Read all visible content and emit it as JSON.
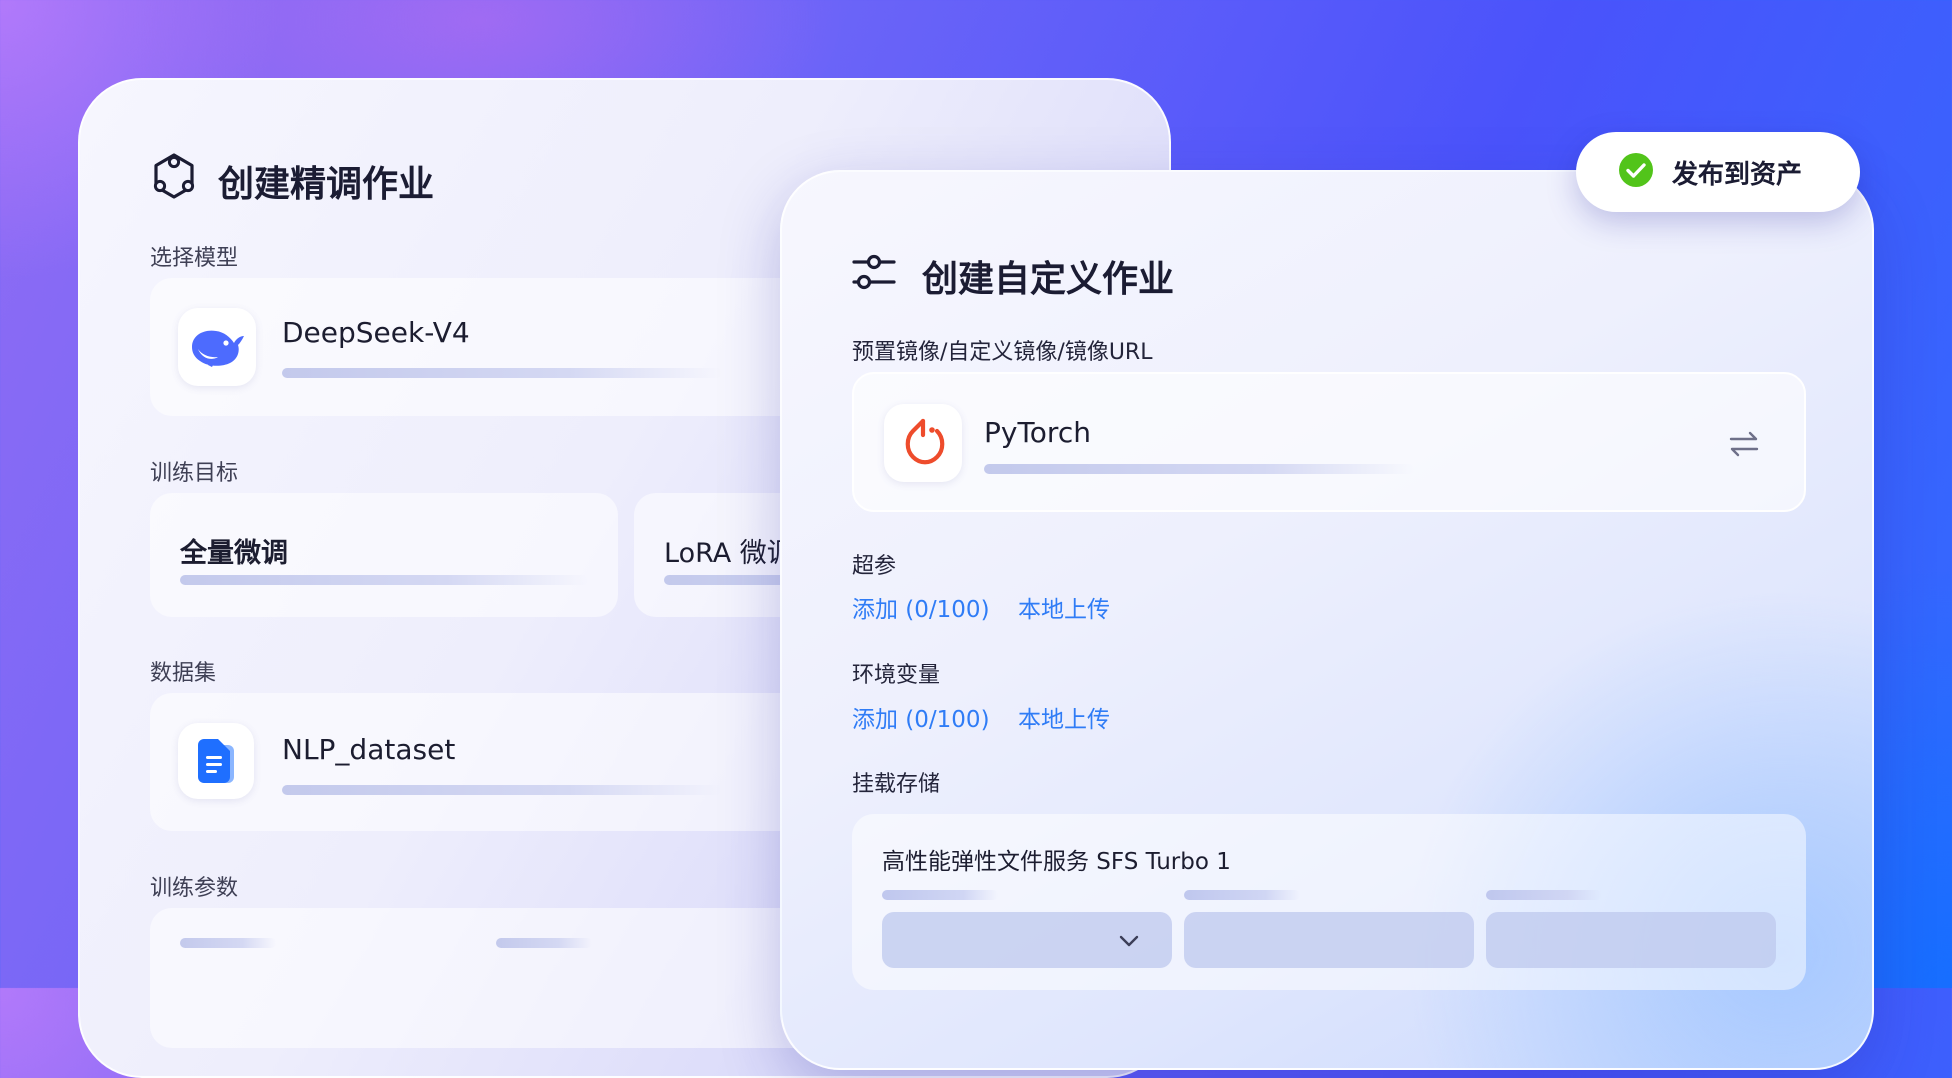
{
  "fine_tune_card": {
    "title": "创建精调作业",
    "title_icon": "hexagon-network-icon",
    "model_section": {
      "label": "选择模型",
      "model_name": "DeepSeek-V4",
      "model_icon": "deepseek-whale-icon"
    },
    "target_section": {
      "label": "训练目标",
      "options": [
        {
          "label": "全量微调"
        },
        {
          "label": "LoRA 微调"
        }
      ]
    },
    "dataset_section": {
      "label": "数据集",
      "dataset_name": "NLP_dataset",
      "dataset_icon": "document-icon"
    },
    "params_section": {
      "label": "训练参数"
    }
  },
  "custom_job_card": {
    "title": "创建自定义作业",
    "title_icon": "sliders-icon",
    "image_section": {
      "label": "预置镜像/自定义镜像/镜像URL",
      "image_name": "PyTorch",
      "image_icon": "pytorch-icon",
      "switch_icon": "swap-arrows-icon"
    },
    "hyperparams_section": {
      "label": "超参",
      "add_label": "添加 (0/100)",
      "upload_label": "本地上传"
    },
    "env_section": {
      "label": "环境变量",
      "add_label": "添加 (0/100)",
      "upload_label": "本地上传"
    },
    "storage_section": {
      "label": "挂载存储",
      "storage_title": "高性能弹性文件服务 SFS Turbo 1",
      "dropdown_icon": "chevron-down-icon"
    }
  },
  "toast": {
    "text": "发布到资产",
    "icon": "check-circle-icon"
  },
  "colors": {
    "link": "#2f7cf6",
    "success": "#52c41a",
    "pytorch": "#ee4c2c",
    "deepseek": "#4d6bfe",
    "doc": "#1f6fff"
  }
}
